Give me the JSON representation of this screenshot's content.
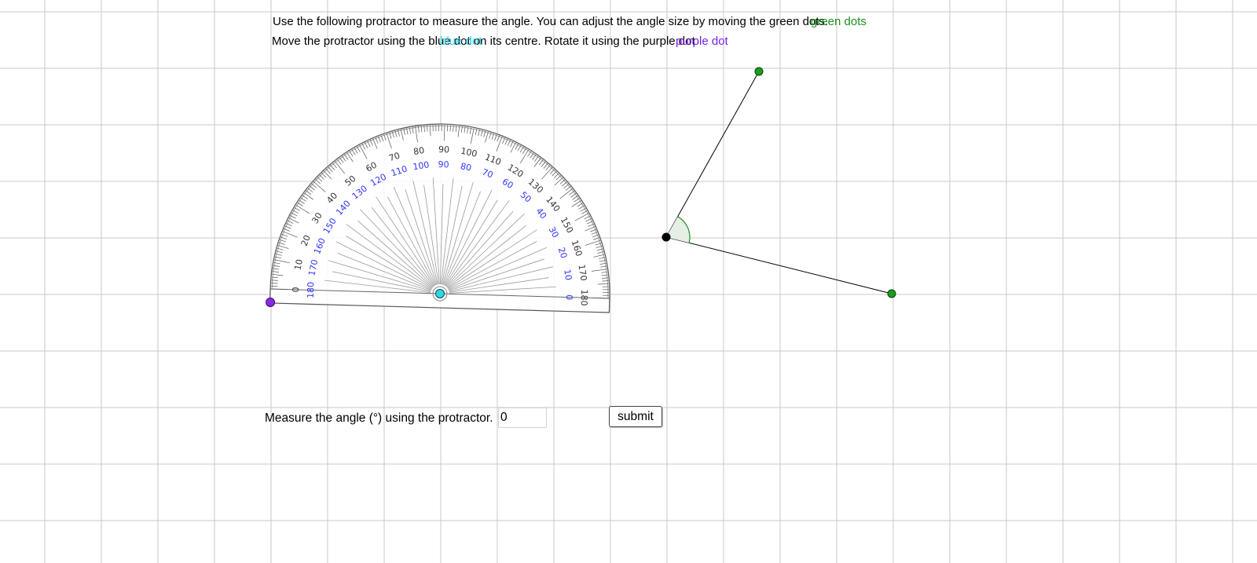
{
  "instructions": {
    "line1": "Use the following protractor to measure the angle. You can adjust the angle size by moving the green dots.",
    "line1_overlay": "green dots",
    "line2": "Move the protractor using the blue dot on its centre. Rotate it using the purple dot",
    "line2_overlay_blue": "blue dot",
    "line2_overlay_purple": "purple dot"
  },
  "question": {
    "label": "Measure the angle (°) using the protractor.",
    "answer_value": "0",
    "submit_label": "submit"
  },
  "protractor": {
    "outer_scale_labels": [
      "0",
      "10",
      "20",
      "30",
      "40",
      "50",
      "60",
      "70",
      "80",
      "90",
      "100",
      "110",
      "120",
      "130",
      "140",
      "150",
      "160",
      "170",
      "180"
    ],
    "inner_scale_labels": [
      "180",
      "170",
      "160",
      "150",
      "140",
      "130",
      "120",
      "110",
      "100",
      "90",
      "80",
      "70",
      "60",
      "50",
      "40",
      "30",
      "20",
      "10",
      "0"
    ],
    "rotation_degrees": 1.6
  },
  "colors": {
    "outer_scale": "#333333",
    "inner_scale": "#3333ff",
    "green_dot": "#1a9e1a",
    "blue_dot": "#2fd6e8",
    "purple_dot": "#8a2be2",
    "vertex_dot": "#000000",
    "angle_fill": "#e3f0e3",
    "angle_stroke": "#2e8b2e",
    "grid": "#c8c8c8",
    "green_text": "#1b8f1b",
    "blue_text": "#27d3ea",
    "purple_text": "#7a1ef0"
  },
  "icons": {
    "vertex": "black-dot-icon",
    "arm_ends": "green-dot-icon",
    "move_handle": "blue-dot-icon",
    "rotate_handle": "purple-dot-icon"
  }
}
